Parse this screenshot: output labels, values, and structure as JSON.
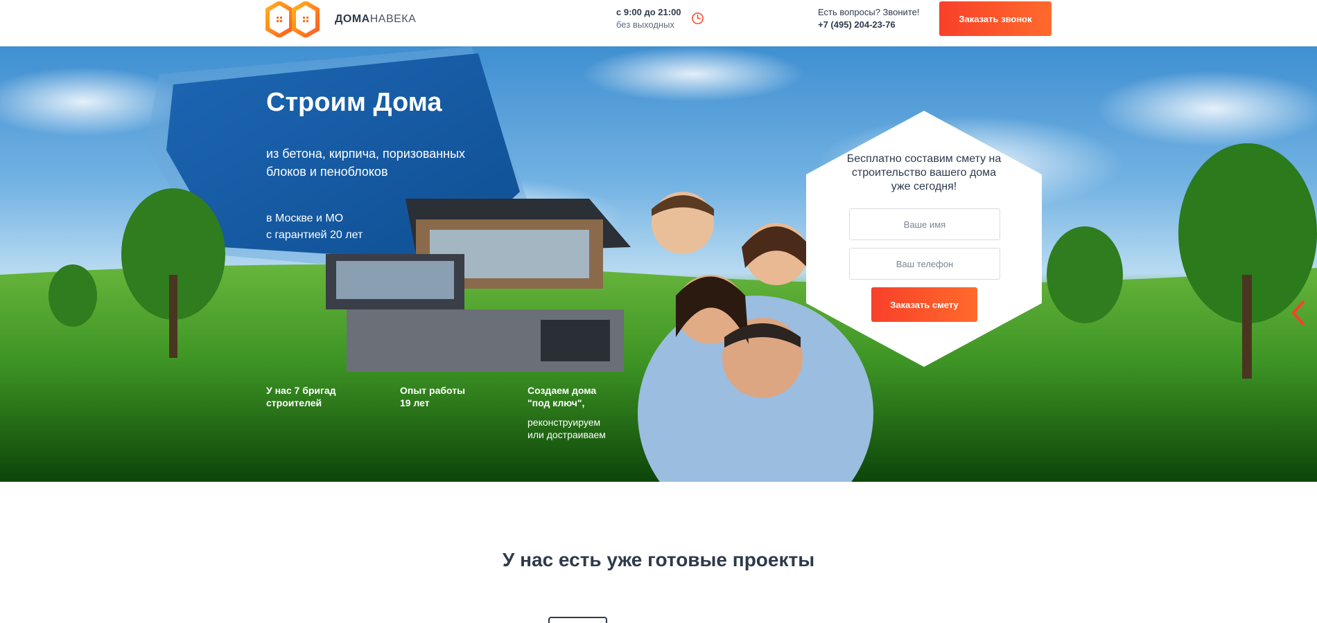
{
  "colors": {
    "accent": "#f84029",
    "accent_end": "#ff6a2c",
    "text_dark": "#2e3a4b",
    "hero_panel": "#1a5fa8"
  },
  "header": {
    "logo": {
      "bold": "ДОМА",
      "rest": "НАВЕКА"
    },
    "hours": {
      "line1": "с 9:00 до 21:00",
      "line2": "без выходных",
      "icon": "clock-icon"
    },
    "contact": {
      "question": "Есть вопросы? Звоните!",
      "phone": "+7 (495) 204-23-76"
    },
    "call_button": "Заказать звонок"
  },
  "hero": {
    "title": "Строим Дома",
    "subtitle": "из бетона, кирпича, поризованных блоков и пеноблоков",
    "region_line1": "в Москве и МО",
    "region_line2": "с гарантией 20 лет",
    "facts": [
      {
        "line1": "У нас 7 бригад",
        "line2": "строителей"
      },
      {
        "line1": "Опыт работы",
        "line2": "19 лет"
      },
      {
        "line1": "Создаем дома",
        "line2": "\"под ключ\",",
        "line3": "реконструируем",
        "line4": "или достраиваем"
      }
    ],
    "slider_arrow_icon": "chevron-right-icon"
  },
  "estimate_form": {
    "title": "Бесплатно составим смету на строительство вашего дома уже сегодня!",
    "name_placeholder": "Ваше имя",
    "phone_placeholder": "Ваш телефон",
    "submit": "Заказать смету"
  },
  "projects": {
    "title": "У нас есть уже готовые проекты"
  }
}
